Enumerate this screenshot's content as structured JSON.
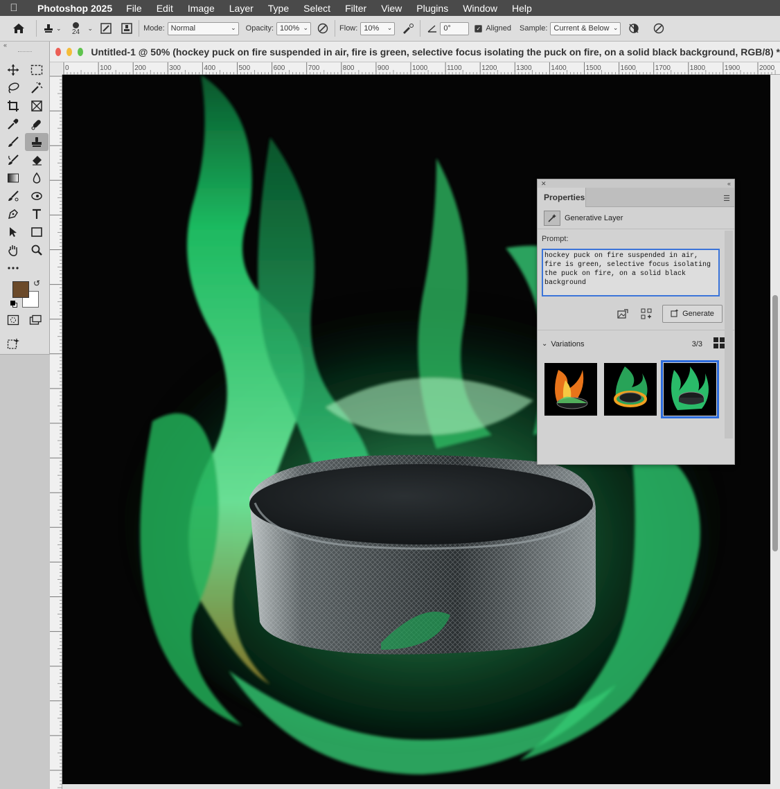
{
  "menubar": {
    "app_name": "Photoshop 2025",
    "items": [
      "File",
      "Edit",
      "Image",
      "Layer",
      "Type",
      "Select",
      "Filter",
      "View",
      "Plugins",
      "Window",
      "Help"
    ]
  },
  "options": {
    "brush_size": "24",
    "mode_label": "Mode:",
    "mode_value": "Normal",
    "opacity_label": "Opacity:",
    "opacity_value": "100%",
    "flow_label": "Flow:",
    "flow_value": "10%",
    "angle_value": "0°",
    "aligned_label": "Aligned",
    "aligned_checked": true,
    "sample_label": "Sample:",
    "sample_value": "Current & Below"
  },
  "toolbox": {
    "foreground_color": "#6b4a2a",
    "background_color": "#ffffff",
    "tools": [
      "move",
      "marquee",
      "lasso",
      "magic-wand",
      "crop",
      "frame",
      "eyedropper",
      "spot-heal",
      "brush",
      "clone-stamp",
      "history-brush",
      "eraser",
      "gradient",
      "blur",
      "dodge",
      "smudge",
      "pen",
      "type",
      "path-select",
      "rectangle",
      "hand",
      "zoom"
    ],
    "active_tool": "clone-stamp"
  },
  "document": {
    "title": "Untitled-1 @ 50% (hockey puck on fire suspended in air, fire is green, selective focus isolating the puck on fire, on a solid black background, RGB/8) *",
    "ruler_h": [
      "0",
      "100",
      "200",
      "300",
      "400",
      "500",
      "600",
      "700",
      "800",
      "900",
      "1000",
      "1100",
      "1200",
      "1300",
      "1400",
      "1500",
      "1600",
      "1700",
      "1800",
      "1900",
      "2000"
    ]
  },
  "properties": {
    "tab_label": "Properties",
    "layer_type": "Generative Layer",
    "prompt_label": "Prompt:",
    "prompt_text": "hockey puck on fire suspended in air, fire is green, selective focus isolating the puck on fire, on a solid black background",
    "generate_label": "Generate",
    "variations_label": "Variations",
    "variations_count": "3/3",
    "selected_variation": 3
  }
}
